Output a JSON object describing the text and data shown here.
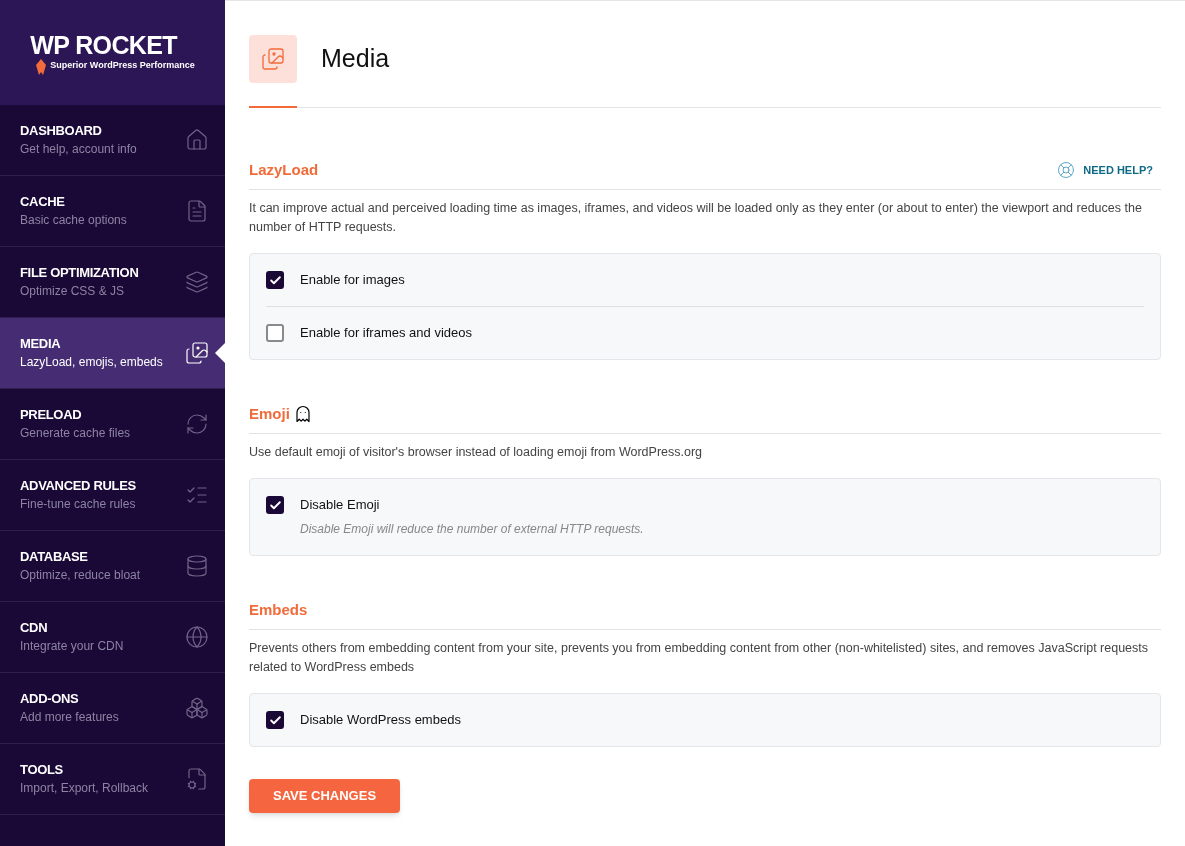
{
  "logo": {
    "name": "WP ROCKET",
    "tagline": "Superior WordPress Performance"
  },
  "sidebar": {
    "items": [
      {
        "title": "DASHBOARD",
        "subtitle": "Get help, account info",
        "selected": false
      },
      {
        "title": "CACHE",
        "subtitle": "Basic cache options",
        "selected": false
      },
      {
        "title": "FILE OPTIMIZATION",
        "subtitle": "Optimize CSS & JS",
        "selected": false
      },
      {
        "title": "MEDIA",
        "subtitle": "LazyLoad, emojis, embeds",
        "selected": true
      },
      {
        "title": "PRELOAD",
        "subtitle": "Generate cache files",
        "selected": false
      },
      {
        "title": "ADVANCED RULES",
        "subtitle": "Fine-tune cache rules",
        "selected": false
      },
      {
        "title": "DATABASE",
        "subtitle": "Optimize, reduce bloat",
        "selected": false
      },
      {
        "title": "CDN",
        "subtitle": "Integrate your CDN",
        "selected": false
      },
      {
        "title": "ADD-ONS",
        "subtitle": "Add more features",
        "selected": false
      },
      {
        "title": "TOOLS",
        "subtitle": "Import, Export, Rollback",
        "selected": false
      }
    ]
  },
  "page": {
    "title": "Media"
  },
  "sections": [
    {
      "title": "LazyLoad",
      "help": "NEED HELP?",
      "title_icon": false,
      "description": "It can improve actual and perceived loading time as images, iframes, and videos will be loaded only as they enter (or about to enter) the viewport and reduces the number of HTTP requests.",
      "options": [
        {
          "label": "Enable for images",
          "checked": true
        },
        {
          "label": "Enable for iframes and videos",
          "checked": false
        }
      ]
    },
    {
      "title": "Emoji",
      "title_icon": true,
      "description": "Use default emoji of visitor's browser instead of loading emoji from WordPress.org",
      "options": [
        {
          "label": "Disable Emoji",
          "checked": true,
          "hint": "Disable Emoji will reduce the number of external HTTP requests."
        }
      ]
    },
    {
      "title": "Embeds",
      "title_icon": false,
      "description": "Prevents others from embedding content from your site, prevents you from embedding content from other (non-whitelisted) sites, and removes JavaScript requests related to WordPress embeds",
      "options": [
        {
          "label": "Disable WordPress embeds",
          "checked": true
        }
      ]
    }
  ],
  "save_button": "SAVE CHANGES"
}
